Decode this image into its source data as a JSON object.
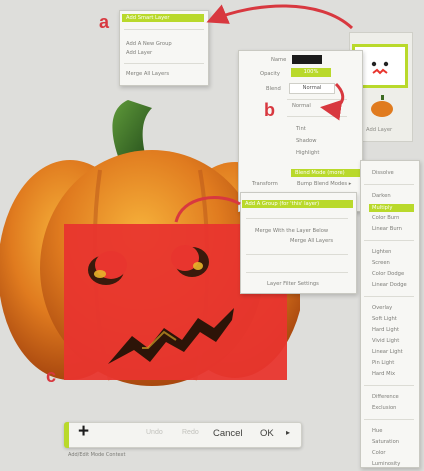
{
  "annotations": {
    "a": "a",
    "b": "b",
    "c": "c"
  },
  "menu_a": {
    "items": [
      "Add Smart Layer",
      "Add A New Group",
      "Add Layer",
      "Merge All Layers"
    ]
  },
  "props": {
    "name_label": "Name",
    "opacity_label": "Opacity",
    "opacity_value": "100%",
    "blend_label": "Blend",
    "blend_value": "Normal",
    "transform_label": "Transform"
  },
  "blend_sub": {
    "items": [
      "Normal",
      "Tint",
      "Shadow",
      "Highlight"
    ]
  },
  "layer_menu": {
    "items": [
      "Blend Mode (more)",
      "Bump Blend Modes ▸",
      "Add A Group (for 'this' layer)",
      "Merge With the Layer Below",
      "Merge All Layers",
      "Layer Filter Settings"
    ]
  },
  "modes": {
    "items": [
      "Dissolve",
      "Darken",
      "Multiply",
      "Color Burn",
      "Linear Burn",
      "Lighten",
      "Screen",
      "Color Dodge",
      "Linear Dodge",
      "Overlay",
      "Soft Light",
      "Hard Light",
      "Vivid Light",
      "Linear Light",
      "Pin Light",
      "Hard Mix",
      "Difference",
      "Exclusion",
      "Hue",
      "Saturation",
      "Color",
      "Luminosity"
    ],
    "selected": "Multiply"
  },
  "layers_panel": {
    "thumb_label": "Add Layer"
  },
  "toolbar": {
    "add_label": "+",
    "undo_label": "Undo",
    "redo_label": "Redo",
    "cancel_label": "Cancel",
    "ok_label": "OK",
    "arrow_label": "▸"
  },
  "caption": {
    "text": "Add/Edit Mode  Context"
  },
  "colors": {
    "accent": "#b9d92b",
    "annotation": "#d8383f",
    "pumpkin": "#e07b1f",
    "red_layer": "#e8352e"
  }
}
